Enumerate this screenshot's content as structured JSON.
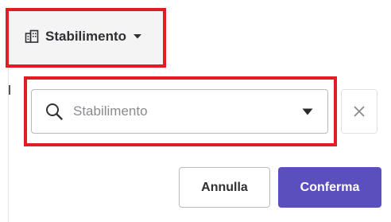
{
  "filter": {
    "label": "Stabilimento",
    "icon": "building-icon"
  },
  "select": {
    "placeholder": "Stabilimento",
    "search_icon": "search-icon",
    "dropdown_icon": "caret-down-icon"
  },
  "clear_icon": "close-icon",
  "buttons": {
    "cancel": "Annulla",
    "confirm": "Conferma"
  },
  "colors": {
    "accent": "#5b4fbe",
    "highlight": "#e31b23",
    "trigger_bg": "#f4f4f5"
  }
}
